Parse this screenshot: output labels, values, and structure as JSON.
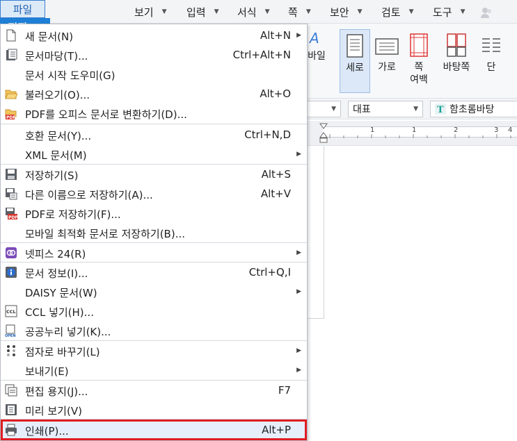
{
  "menubar": {
    "file": "파일",
    "edit": "편집",
    "items": [
      "보기",
      "입력",
      "서식",
      "쪽",
      "보안",
      "검토",
      "도구"
    ]
  },
  "ribbon": {
    "partial_label": "바일",
    "buttons": [
      {
        "label": "세로",
        "icon": "portrait-page-icon"
      },
      {
        "label": "가로",
        "icon": "landscape-page-icon"
      },
      {
        "label": "쪽\n여백",
        "icon": "page-margin-icon"
      },
      {
        "label": "바탕쪽",
        "icon": "master-page-icon"
      },
      {
        "label": "단",
        "icon": "columns-icon"
      }
    ]
  },
  "toolbar2": {
    "style_combo": "대표",
    "font_combo": "함초롬바탕"
  },
  "ruler": {
    "ticks": [
      "1",
      "1",
      "2",
      "3",
      "4"
    ]
  },
  "file_menu": {
    "items": [
      {
        "label": "새 문서(N)",
        "shortcut": "Alt+N",
        "submenu": true,
        "icon": "new-document-icon"
      },
      {
        "label": "문서마당(T)...",
        "shortcut": "Ctrl+Alt+N",
        "submenu": false,
        "icon": "template-icon"
      },
      {
        "label": "문서 시작 도우미(G)",
        "shortcut": "",
        "submenu": false,
        "icon": ""
      },
      {
        "label": "불러오기(O)...",
        "shortcut": "Alt+O",
        "submenu": false,
        "icon": "open-folder-icon"
      },
      {
        "label": "PDF를 오피스 문서로 변환하기(D)...",
        "shortcut": "",
        "submenu": false,
        "icon": "pdf-convert-icon"
      },
      {
        "label": "호환 문서(Y)...",
        "shortcut": "Ctrl+N,D",
        "submenu": false,
        "icon": ""
      },
      {
        "label": "XML 문서(M)",
        "shortcut": "",
        "submenu": true,
        "icon": ""
      },
      {
        "label": "저장하기(S)",
        "shortcut": "Alt+S",
        "submenu": false,
        "icon": "save-icon"
      },
      {
        "label": "다른 이름으로 저장하기(A)...",
        "shortcut": "Alt+V",
        "submenu": false,
        "icon": "save-as-icon"
      },
      {
        "label": "PDF로 저장하기(F)...",
        "shortcut": "",
        "submenu": false,
        "icon": "save-pdf-icon"
      },
      {
        "label": "모바일 최적화 문서로 저장하기(B)...",
        "shortcut": "",
        "submenu": false,
        "icon": ""
      },
      {
        "label": "넷피스 24(R)",
        "shortcut": "",
        "submenu": true,
        "icon": "netffice-icon"
      },
      {
        "label": "문서 정보(I)...",
        "shortcut": "Ctrl+Q,I",
        "submenu": false,
        "icon": "info-icon"
      },
      {
        "label": "DAISY 문서(W)",
        "shortcut": "",
        "submenu": true,
        "icon": ""
      },
      {
        "label": "CCL 넣기(H)...",
        "shortcut": "",
        "submenu": false,
        "icon": "ccl-icon"
      },
      {
        "label": "공공누리 넣기(K)...",
        "shortcut": "",
        "submenu": false,
        "icon": "kogl-icon"
      },
      {
        "label": "점자로 바꾸기(L)",
        "shortcut": "",
        "submenu": true,
        "icon": "braille-icon"
      },
      {
        "label": "보내기(E)",
        "shortcut": "",
        "submenu": true,
        "icon": ""
      },
      {
        "label": "편집 용지(J)...",
        "shortcut": "F7",
        "submenu": false,
        "icon": "page-setup-icon"
      },
      {
        "label": "미리 보기(V)",
        "shortcut": "",
        "submenu": false,
        "icon": "preview-icon"
      },
      {
        "label": "인쇄(P)...",
        "shortcut": "Alt+P",
        "submenu": false,
        "icon": "print-icon"
      }
    ]
  },
  "colors": {
    "accent": "#1e7fd6",
    "highlight_border": "#e01c22",
    "menu_hover": "#e6eefb"
  }
}
